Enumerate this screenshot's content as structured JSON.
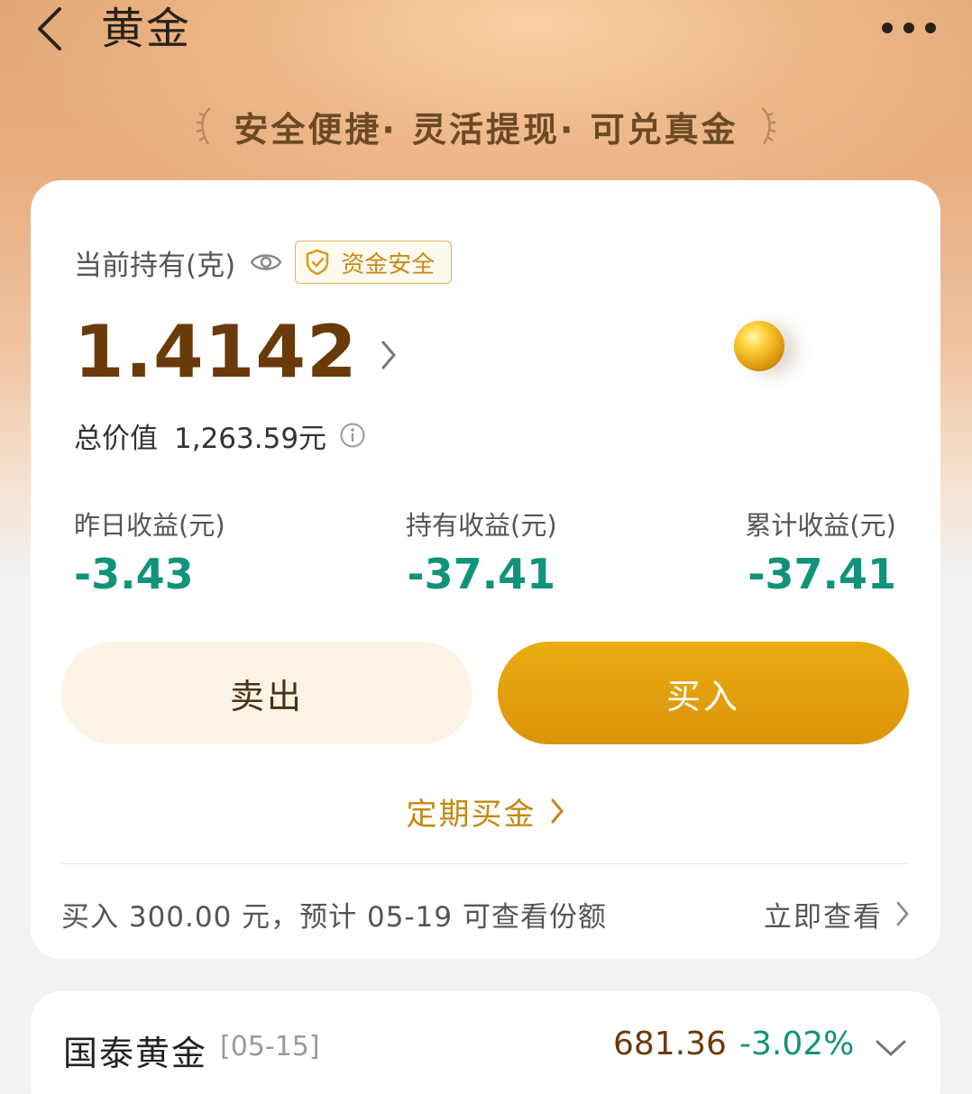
{
  "header": {
    "title": "黄金",
    "back_icon": "chevron-left-icon",
    "more_icon": "more-horizontal-icon"
  },
  "slogan": {
    "text": "安全便捷· 灵活提现· 可兑真金"
  },
  "holding": {
    "label": "当前持有(克)",
    "badge": "资金安全",
    "amount": "1.4142",
    "total_label": "总价值",
    "total_value": "1,263.59元"
  },
  "stats": [
    {
      "label": "昨日收益(元)",
      "value": "-3.43"
    },
    {
      "label": "持有收益(元)",
      "value": "-37.41"
    },
    {
      "label": "累计收益(元)",
      "value": "-37.41"
    }
  ],
  "actions": {
    "sell_label": "卖出",
    "buy_label": "买入",
    "plan_label": "定期买金"
  },
  "notice": {
    "text": "买入 300.00 元，预计 05-19 可查看份额",
    "action_label": "立即查看"
  },
  "fund": {
    "name": "国泰黄金",
    "date": "[05-15]",
    "price": "681.36",
    "change": "-3.02%"
  },
  "colors": {
    "accent": "#dc9309",
    "negative": "#11937a",
    "amount": "#6b3a0a"
  }
}
